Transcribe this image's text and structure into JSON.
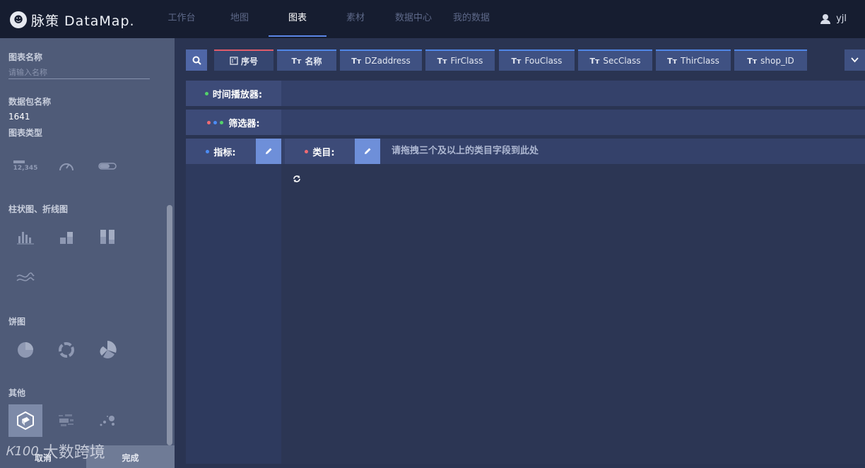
{
  "brand": {
    "mark": "☻",
    "name": "脉策 DataMap."
  },
  "nav": {
    "items": [
      {
        "label": "工作台",
        "active": false
      },
      {
        "label": "地图",
        "active": false
      },
      {
        "label": "图表",
        "active": true
      },
      {
        "label": "素材",
        "active": false
      },
      {
        "label": "数据中心",
        "active": false
      },
      {
        "label": "我的数据",
        "active": false
      }
    ],
    "user": "yjl"
  },
  "side": {
    "chart_name_label": "图表名称",
    "chart_name_placeholder": "请输入名称",
    "package_label": "数据包名称",
    "package_value": "1641",
    "chart_type_label": "图表类型",
    "kpi_number_sample": "12,345",
    "group_bar_line": "柱状图、折线图",
    "group_pie": "饼图",
    "group_other": "其他",
    "cancel": "取消",
    "done": "完成"
  },
  "fields": {
    "index": "序号",
    "tt": "Tт",
    "chips": [
      "名称",
      "DZaddress",
      "FirClass",
      "FouClass",
      "SecClass",
      "ThirClass",
      "shop_ID"
    ]
  },
  "slots": {
    "time_player": "时间播放器:",
    "filter": "筛选器:",
    "metric": "指标:",
    "category": "类目:",
    "category_hint": "请拖拽三个及以上的类目字段到此处"
  },
  "watermark": {
    "mark": "Ꮶ100",
    "text": "大数跨境"
  },
  "colors": {
    "accent": "#5c86e6",
    "index_border": "#e05c6a",
    "edit_btn": "#6e8fd9"
  }
}
